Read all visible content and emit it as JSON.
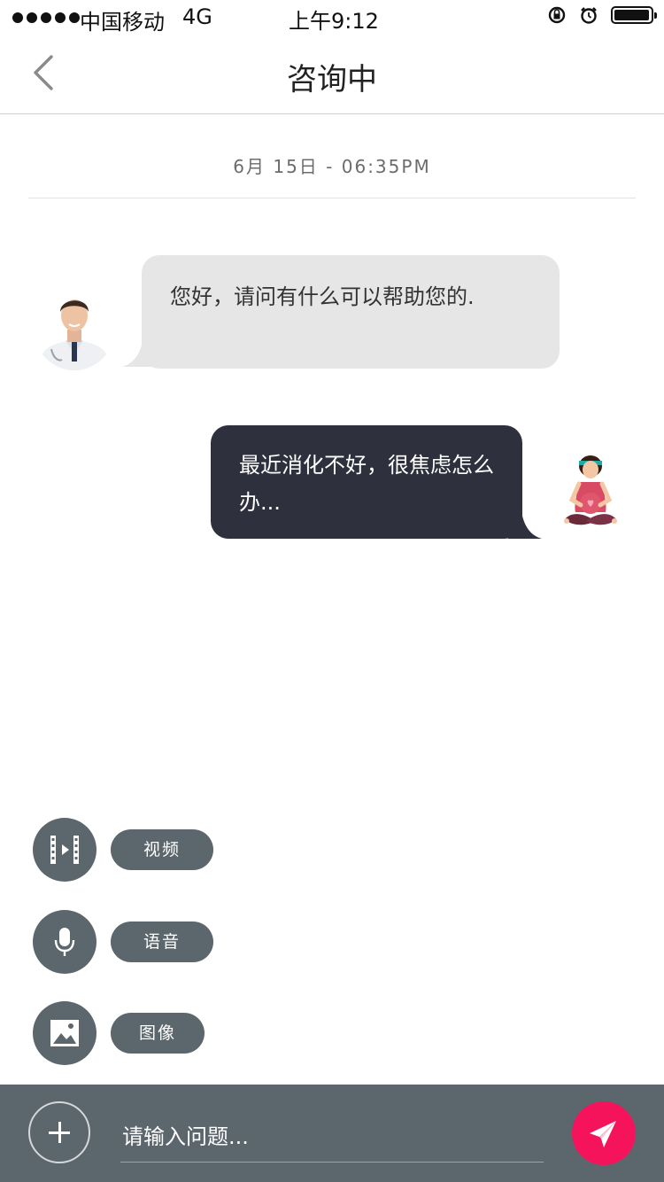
{
  "status_bar": {
    "carrier": "中国移动",
    "network": "4G",
    "time": "上午9:12",
    "battery_level": 0.9
  },
  "nav": {
    "title": "咨询中",
    "back_icon": "chevron-left-icon"
  },
  "chat": {
    "timestamp": "6月 15日 - 06:35PM",
    "messages": [
      {
        "sender": "doctor",
        "text": "您好，请问有什么可以帮助您的."
      },
      {
        "sender": "patient",
        "text": "最近消化不好，很焦虑怎么办..."
      }
    ]
  },
  "options": [
    {
      "icon": "film-icon",
      "label": "视频"
    },
    {
      "icon": "microphone-icon",
      "label": "语音"
    },
    {
      "icon": "image-icon",
      "label": "图像"
    }
  ],
  "input_bar": {
    "placeholder": "请输入问题...",
    "add_icon": "plus-icon",
    "send_icon": "paper-plane-icon"
  },
  "colors": {
    "panel": "#5c666d",
    "bubble_incoming": "#e6e6e6",
    "bubble_outgoing": "#2e313d",
    "send_accent": "#f5145c"
  }
}
